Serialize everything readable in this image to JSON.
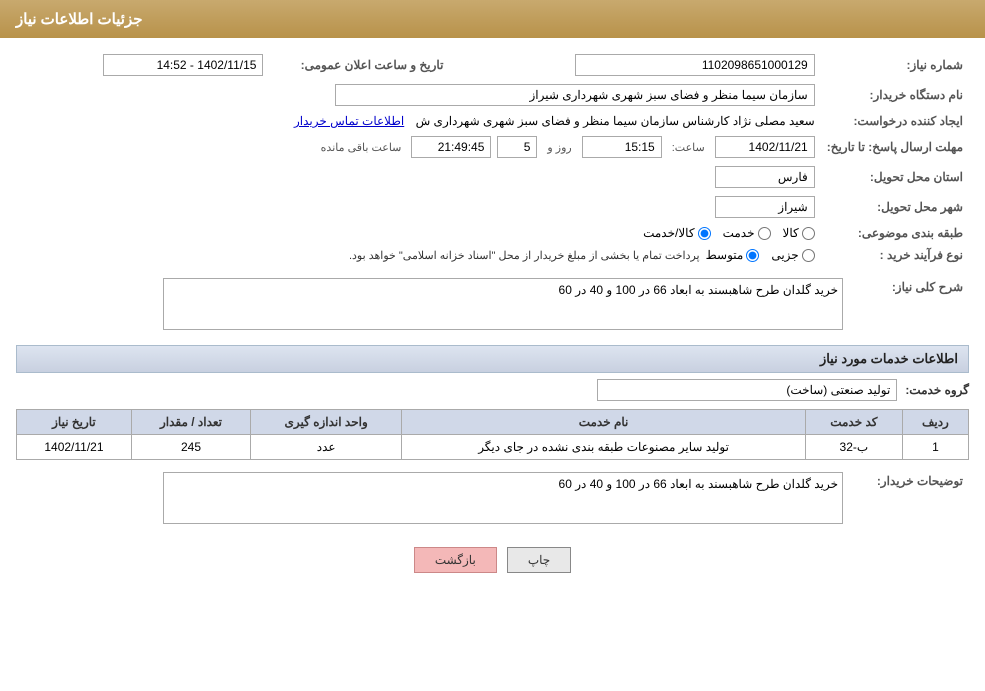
{
  "header": {
    "title": "جزئیات اطلاعات نیاز"
  },
  "fields": {
    "need_number_label": "شماره نیاز:",
    "need_number_value": "1102098651000129",
    "announce_date_label": "تاریخ و ساعت اعلان عمومی:",
    "announce_date_value": "1402/11/15 - 14:52",
    "buyer_org_label": "نام دستگاه خریدار:",
    "buyer_org_value": "سازمان سیما منظر و فضای سبز شهری شهرداری شیراز",
    "creator_label": "ایجاد کننده درخواست:",
    "creator_value": "سعید مصلی نژاد کارشناس سازمان سیما منظر و فضای سبز شهری شهرداری ش",
    "creator_link": "اطلاعات تماس خریدار",
    "deadline_label": "مهلت ارسال پاسخ: تا تاریخ:",
    "deadline_date": "1402/11/21",
    "deadline_time_label": "ساعت:",
    "deadline_time": "15:15",
    "deadline_days_label": "روز و",
    "deadline_days": "5",
    "deadline_remaining_label": "ساعت باقی مانده",
    "deadline_remaining": "21:49:45",
    "province_label": "استان محل تحویل:",
    "province_value": "فارس",
    "city_label": "شهر محل تحویل:",
    "city_value": "شیراز",
    "category_label": "طبقه بندی موضوعی:",
    "category_options": [
      "کالا",
      "خدمت",
      "کالا/خدمت"
    ],
    "category_selected": "کالا",
    "purchase_type_label": "نوع فرآیند خرید :",
    "purchase_options": [
      "جزیی",
      "متوسط"
    ],
    "purchase_note": "پرداخت تمام یا بخشی از مبلغ خریدار از محل \"اسناد خزانه اسلامی\" خواهد بود.",
    "need_description_label": "شرح کلی نیاز:",
    "need_description_value": "خرید گلدان طرح شاهبسند به ابعاد 66 در 100 و 40 در 60",
    "services_section_label": "اطلاعات خدمات مورد نیاز",
    "service_group_label": "گروه خدمت:",
    "service_group_value": "تولید صنعتی (ساخت)",
    "table": {
      "headers": [
        "ردیف",
        "کد خدمت",
        "نام خدمت",
        "واحد اندازه گیری",
        "تعداد / مقدار",
        "تاریخ نیاز"
      ],
      "rows": [
        {
          "row_num": "1",
          "service_code": "ب-32",
          "service_name": "تولید سایر مصنوعات طبقه بندی نشده در جای دیگر",
          "unit": "عدد",
          "quantity": "245",
          "date": "1402/11/21"
        }
      ]
    },
    "buyer_description_label": "توضیحات خریدار:",
    "buyer_description_value": "خرید گلدان طرح شاهبسند به ابعاد 66 در 100 و 40 در 60"
  },
  "buttons": {
    "print_label": "چاپ",
    "back_label": "بازگشت"
  }
}
